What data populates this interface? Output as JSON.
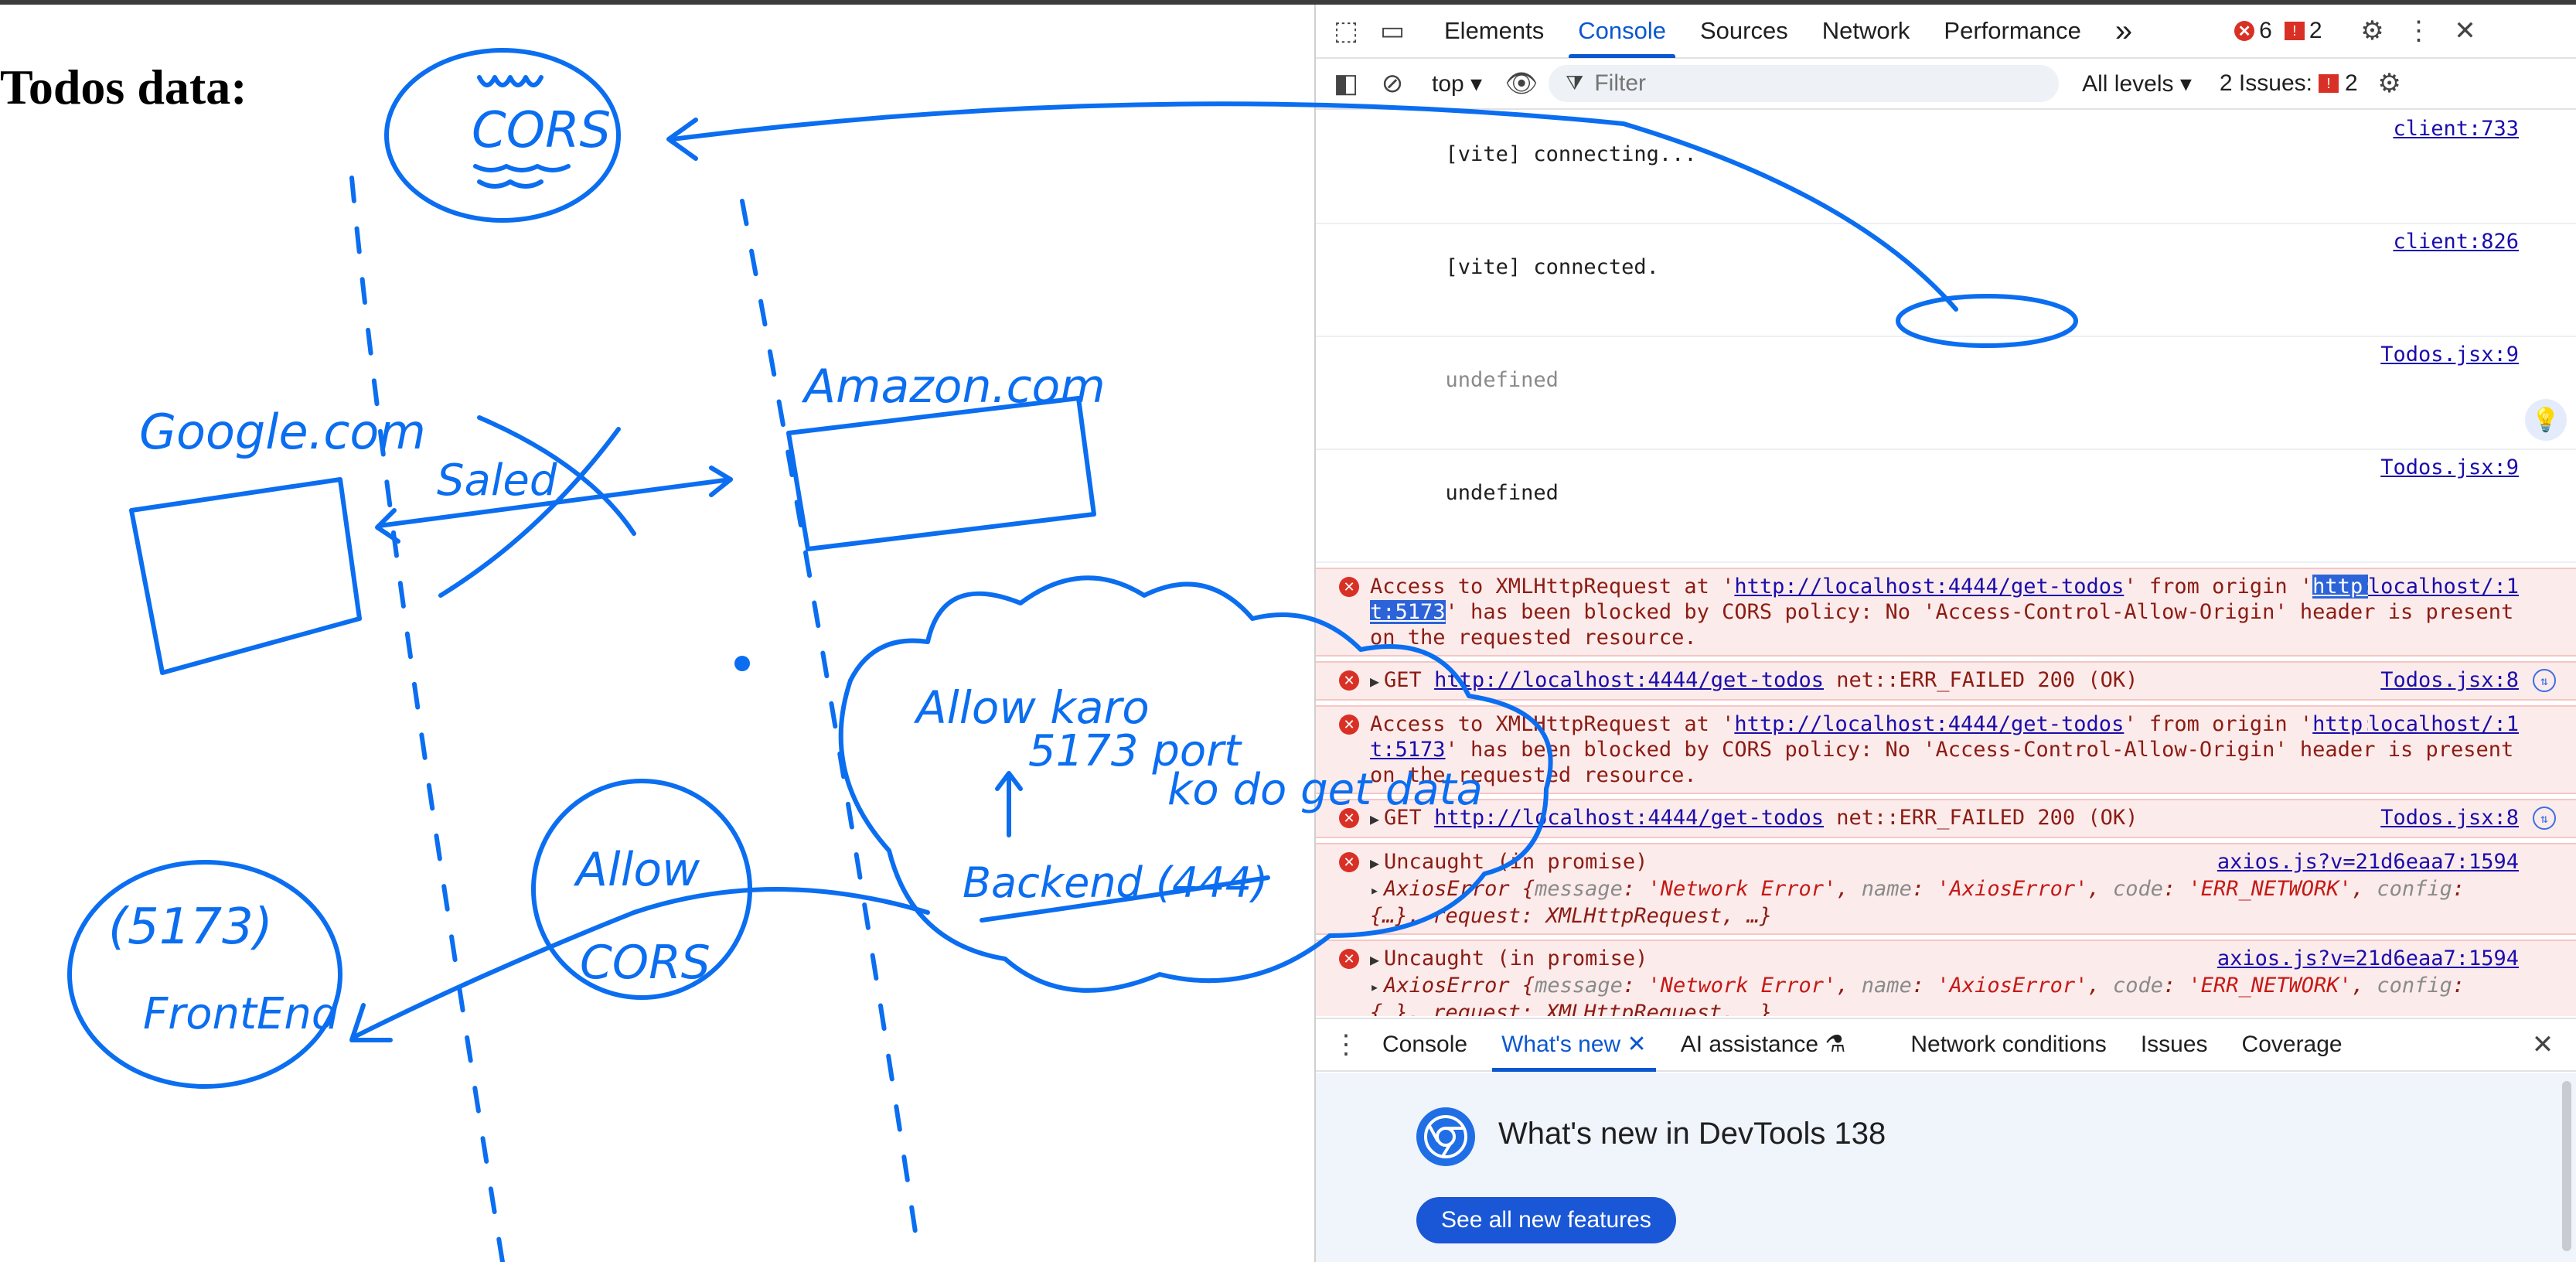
{
  "page": {
    "title": "Todos data:"
  },
  "sketch": {
    "labels": {
      "cors": "CORS",
      "google": "Google.com",
      "amazon": "Amazon.com",
      "saled": "Saled",
      "allow_karo": "Allow karo",
      "port_line1": "5173 port",
      "port_line2": "ko do get data",
      "backend": "Backend (444)",
      "frontend_port": "(5173)",
      "frontend": "FrontEnd",
      "allow": "Allow",
      "cors_circle": "CORS"
    }
  },
  "devtools": {
    "tabs": [
      "Elements",
      "Console",
      "Sources",
      "Network",
      "Performance"
    ],
    "active_tab": "Console",
    "more_tabs": "»",
    "error_count": "6",
    "warning_count": "2",
    "toolbar": {
      "context": "top",
      "filter_placeholder": "Filter",
      "levels": "All levels",
      "issues_label": "2 Issues:",
      "issues_count": "2"
    },
    "console": {
      "messages": [
        {
          "text": "[vite] connecting...",
          "source": "client:733"
        },
        {
          "text": "[vite] connected.",
          "source": "client:826"
        },
        {
          "text": "undefined",
          "source": "Todos.jsx:9"
        },
        {
          "text": "undefined",
          "source": "Todos.jsx:9"
        },
        {
          "pre": "Access to XMLHttpRequest at '",
          "url": "http://localhost:4444/get-todos",
          "mid": "' from origin '",
          "origin": "http://localhost:5173",
          "post": "' has been blocked by CORS policy: No 'Access-Control-Allow-Origin' header is present on the requested resource.",
          "source": "localhost/:1"
        },
        {
          "pre": "GET ",
          "url": "http://localhost:4444/get-todos",
          "post": " net::ERR_FAILED 200 (OK)",
          "source": "Todos.jsx:8"
        },
        {
          "pre": "Access to XMLHttpRequest at '",
          "url": "http://localhost:4444/get-todos",
          "mid": "' from origin '",
          "origin": "http://localhost:5173",
          "post": "' has been blocked by CORS policy: No 'Access-Control-Allow-Origin' header is present on the requested resource.",
          "source": "localhost/:1"
        },
        {
          "pre": "GET ",
          "url": "http://localhost:4444/get-todos",
          "post": " net::ERR_FAILED 200 (OK)",
          "source": "Todos.jsx:8"
        },
        {
          "head": "Uncaught (in promise)",
          "obj": "AxiosError",
          "msg_key": "message",
          "msg_val": "'Network Error'",
          "name_key": "name",
          "name_val": "'AxiosError'",
          "code_key": "code",
          "code_val": "'ERR_NETWORK'",
          "config_key": "config",
          "tail": "{…}, request: XMLHttpRequest, …}",
          "source": "axios.js?v=21d6eaa7:1594"
        },
        {
          "head": "Uncaught (in promise)",
          "obj": "AxiosError",
          "msg_key": "message",
          "msg_val": "'Network Error'",
          "name_key": "name",
          "name_val": "'AxiosError'",
          "code_key": "code",
          "code_val": "'ERR_NETWORK'",
          "config_key": "config",
          "tail": "{…}, request: XMLHttpRequest, …}",
          "source": "axios.js?v=21d6eaa7:1594"
        }
      ]
    },
    "drawer": {
      "tabs": [
        "Console",
        "What's new",
        "AI assistance",
        "Network conditions",
        "Issues",
        "Coverage"
      ],
      "active_tab": "What's new",
      "whats_new_title": "What's new in DevTools 138",
      "see_all_button": "See all new features"
    }
  }
}
